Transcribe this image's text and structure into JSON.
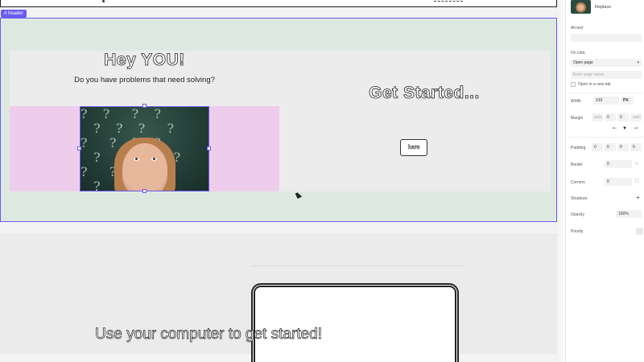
{
  "canvas": {
    "selection_tag": "# header",
    "hero": {
      "title": "Hey YOU!",
      "subtitle": "Do you have problems that need solving?",
      "cta_title": "Get Started...",
      "cta_button": "here",
      "image_pattern": "?  ?   ?  ?\n  ?  ?  ?   ?\n?   ?  ?  ?\n  ?  ?    ?  ?\n?   ?  ?  ?\n  ?   ?  ?  ?"
    },
    "section2": {
      "title": "Use your computer to get started!"
    }
  },
  "panel": {
    "replace": "Replace",
    "alt_text_label": "Alt text",
    "alt_text_value": "",
    "on_click_label": "On click",
    "on_click_value": "Open page",
    "page_name_placeholder": "Enter page name",
    "open_new_tab": "Open in a new tab",
    "width_label": "Width",
    "width_value": "310",
    "width_unit": "PX",
    "margin_label": "Margin",
    "margin_left": "auto",
    "margin_top": "0",
    "margin_bottom": "0",
    "margin_right": "auto",
    "padding_label": "Padding",
    "padding_values": [
      "0",
      "0",
      "0",
      "0"
    ],
    "border_label": "Border",
    "border_value": "0",
    "corners_label": "Corners",
    "corners_value": "0",
    "shadows_label": "Shadows",
    "opacity_label": "Opacity",
    "opacity_value": "100%",
    "priority_label": "Priority"
  },
  "colors": {
    "selection": "#6a5cf0",
    "header_bg": "#dde9e0",
    "hero_bg": "#ececec",
    "pink_band": "#eecdec"
  },
  "icons": [
    "chevron-down-icon",
    "plus-icon",
    "align-center-icon",
    "circle-icon",
    "expand-corners-icon"
  ]
}
